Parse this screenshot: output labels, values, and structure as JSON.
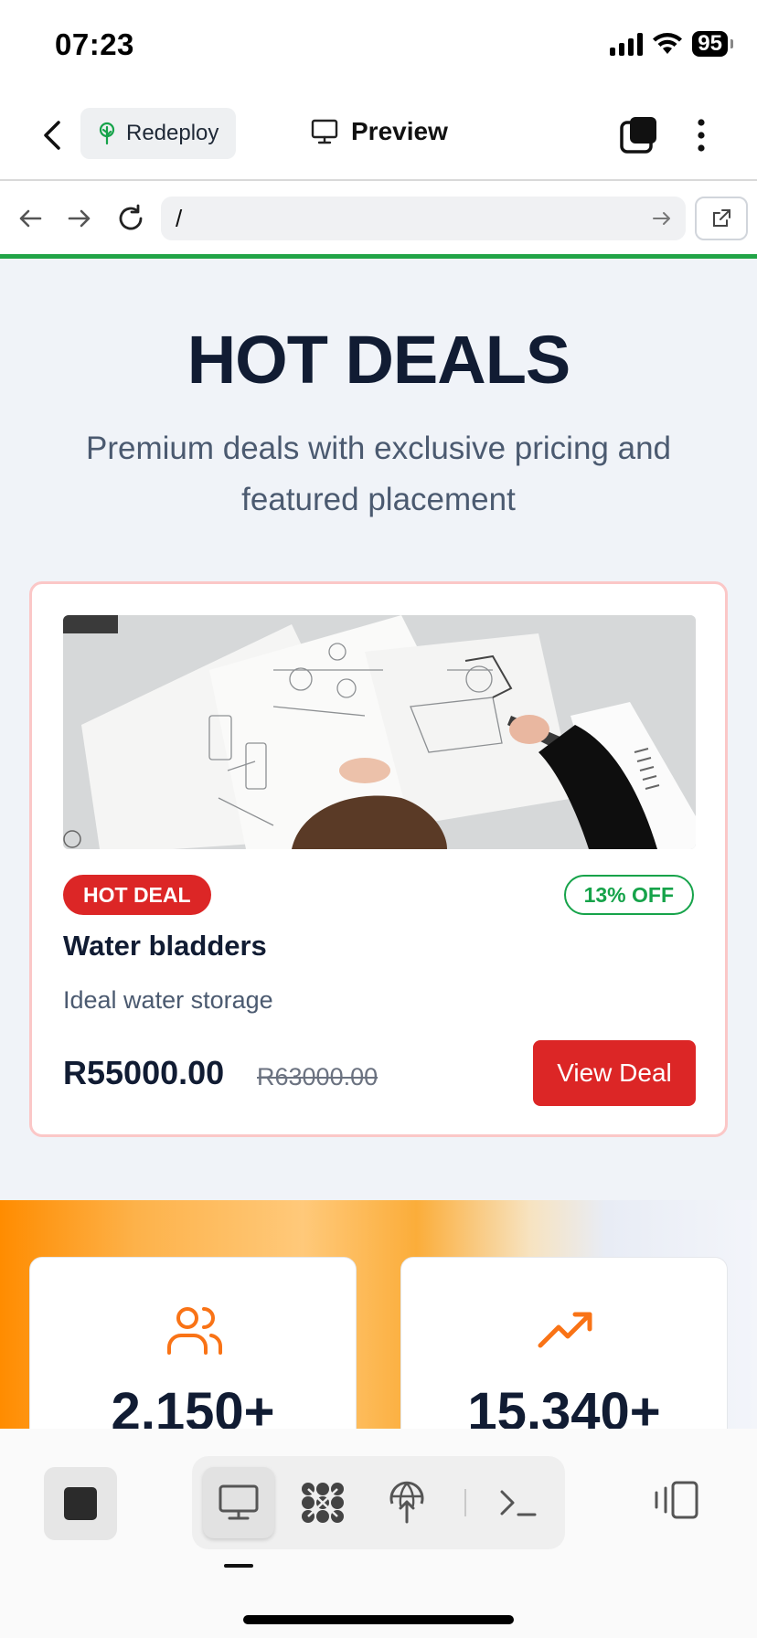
{
  "status_bar": {
    "time": "07:23",
    "battery": "95"
  },
  "app_bar": {
    "redeploy_label": "Redeploy",
    "title": "Preview"
  },
  "browser": {
    "url": "/"
  },
  "hero": {
    "title": "HOT DEALS",
    "subtitle": "Premium deals with exclusive pricing and featured placement"
  },
  "deal": {
    "badge": "HOT DEAL",
    "discount": "13% OFF",
    "title": "Water bladders",
    "description": "Ideal water storage",
    "price": "R55000.00",
    "old_price": "R63000.00",
    "cta": "View Deal"
  },
  "stats": [
    {
      "icon": "users-icon",
      "value": "2,150+"
    },
    {
      "icon": "trending-up-icon",
      "value": "15,340+"
    }
  ],
  "colors": {
    "accent_red": "#dc2626",
    "accent_green": "#16a34a",
    "accent_orange": "#f97316",
    "progress_green": "#22a447"
  }
}
